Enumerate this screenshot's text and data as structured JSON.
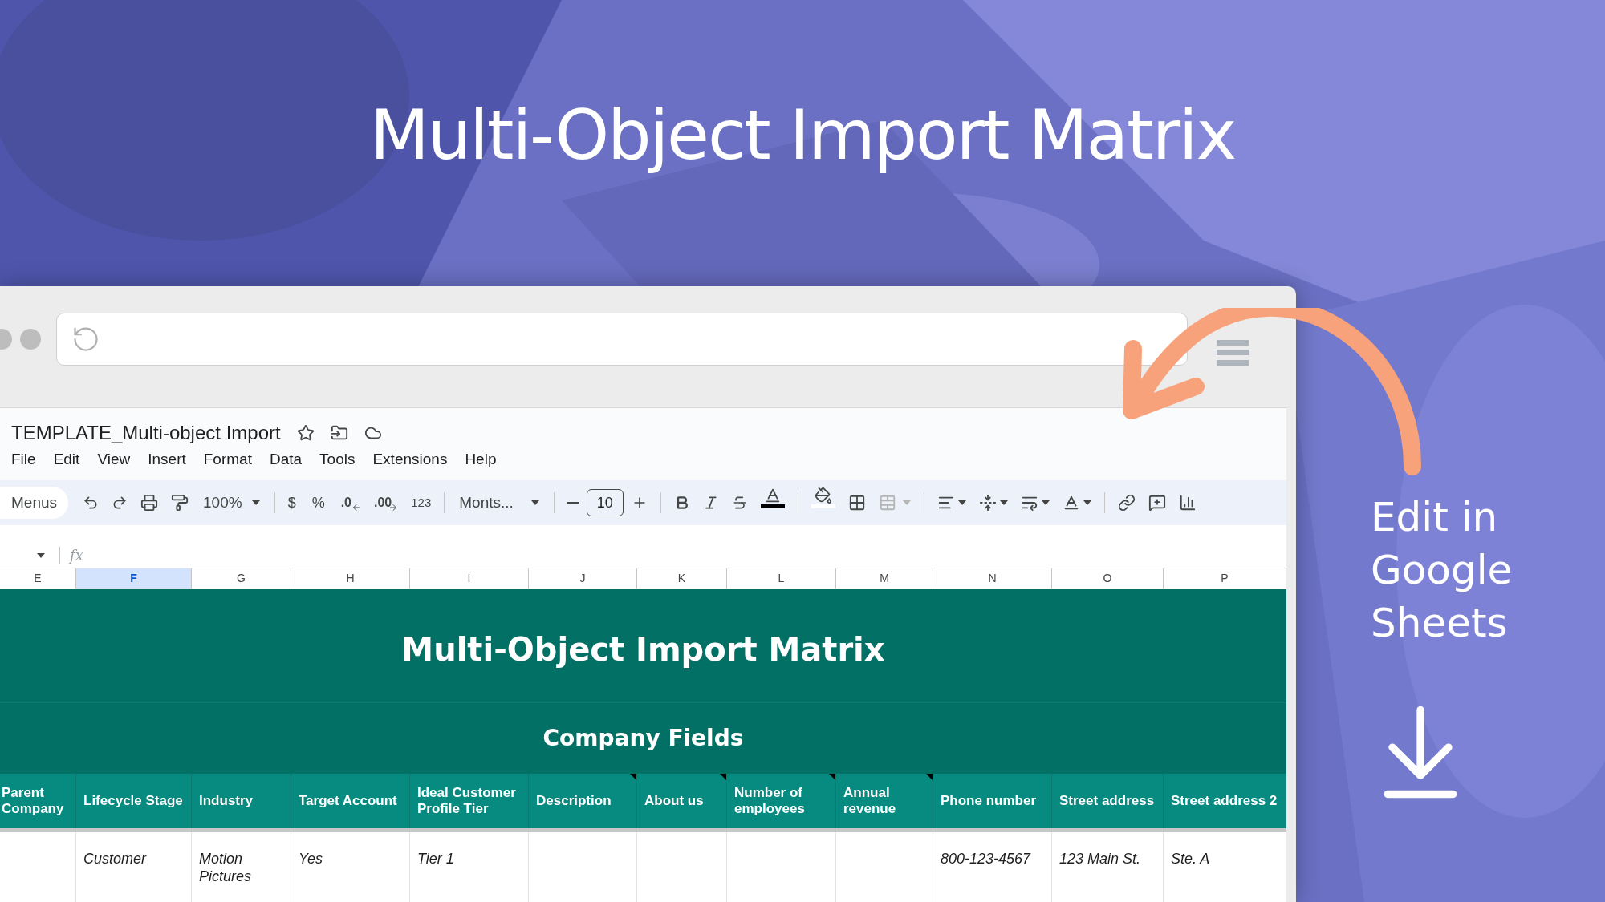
{
  "headline": "Multi-Object Import Matrix",
  "spreadsheet": {
    "title": "TEMPLATE_Multi-object Import",
    "menus": [
      "File",
      "Edit",
      "View",
      "Insert",
      "Format",
      "Data",
      "Tools",
      "Extensions",
      "Help"
    ],
    "toolbar": {
      "menus_button": "Menus",
      "zoom": "100%",
      "currency": "$",
      "percent": "%",
      "decrease_decimals": ".0",
      "increase_decimals": ".00",
      "number_format": "123",
      "font": "Monts...",
      "font_size": "10",
      "merge_disabled": true
    },
    "columns": [
      {
        "label": "E",
        "selected": false
      },
      {
        "label": "F",
        "selected": true
      },
      {
        "label": "G",
        "selected": false
      },
      {
        "label": "H",
        "selected": false
      },
      {
        "label": "I",
        "selected": false
      },
      {
        "label": "J",
        "selected": false
      },
      {
        "label": "K",
        "selected": false
      },
      {
        "label": "L",
        "selected": false
      },
      {
        "label": "M",
        "selected": false
      },
      {
        "label": "N",
        "selected": false
      },
      {
        "label": "O",
        "selected": false
      },
      {
        "label": "P",
        "selected": false
      }
    ],
    "sheet_title": "Multi-Object Import Matrix",
    "section_title": "Company Fields",
    "header_cells": [
      {
        "text": "Parent Company",
        "note": false
      },
      {
        "text": "Lifecycle Stage",
        "note": false
      },
      {
        "text": "Industry",
        "note": false
      },
      {
        "text": "Target Account",
        "note": false
      },
      {
        "text": "Ideal Customer Profile Tier",
        "note": false
      },
      {
        "text": "Description",
        "note": true
      },
      {
        "text": "About us",
        "note": true
      },
      {
        "text": "Number of employees",
        "note": true
      },
      {
        "text": "Annual revenue",
        "note": true
      },
      {
        "text": "Phone number",
        "note": false
      },
      {
        "text": "Street address",
        "note": false
      },
      {
        "text": "Street address 2",
        "note": false
      }
    ],
    "formula_label": "fx",
    "data_row": [
      {
        "kind": "empty"
      },
      {
        "kind": "text",
        "text": "Customer"
      },
      {
        "kind": "text",
        "text": "Motion Pictures"
      },
      {
        "kind": "text",
        "text": "Yes"
      },
      {
        "kind": "text",
        "text": "Tier 1"
      },
      {
        "kind": "empty"
      },
      {
        "kind": "empty"
      },
      {
        "kind": "empty"
      },
      {
        "kind": "empty"
      },
      {
        "kind": "text",
        "text": "800-123-4567"
      },
      {
        "kind": "text",
        "text": "123 Main St."
      },
      {
        "kind": "text",
        "text": "Ste. A"
      }
    ]
  },
  "side_text": "Edit in Google Sheets"
}
